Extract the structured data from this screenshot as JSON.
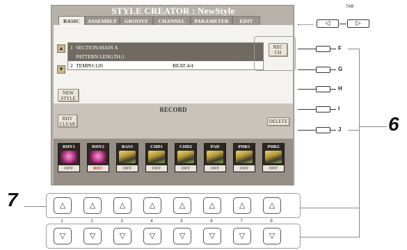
{
  "screen": {
    "title": "STYLE CREATOR : NewStyle",
    "tabs": [
      "BASIC",
      "ASSEMBLY",
      "GROOVE",
      "CHANNEL",
      "PARAMETER",
      "EDIT"
    ],
    "active_tab": "BASIC",
    "info": {
      "row1_num": "1",
      "section": "SECTION:MAIN A",
      "pattern_length": "PATTERN LENGTH:1",
      "row2_num": "2",
      "tempo": "TEMPO:120",
      "beat": "BEAT:4/4"
    },
    "rec_ch_label": "REC\nCH",
    "new_style_label": "NEW\nSTYLE",
    "record_label": "RECORD",
    "rhy_clear_label": "RHY\nCLEAR",
    "delete_label": "DELETE",
    "channels": [
      {
        "name": "RHY1",
        "state": "OFF"
      },
      {
        "name": "RHY2",
        "state": "REC"
      },
      {
        "name": "BASS",
        "state": "OFF"
      },
      {
        "name": "CHD1",
        "state": "OFF"
      },
      {
        "name": "CHD2",
        "state": "OFF"
      },
      {
        "name": "PAD",
        "state": "OFF"
      },
      {
        "name": "PHR1",
        "state": "OFF"
      },
      {
        "name": "PHR2",
        "state": "OFF"
      }
    ]
  },
  "tab_label": "TAB",
  "side_buttons": [
    "F",
    "G",
    "H",
    "I",
    "J"
  ],
  "callouts": {
    "six": "6",
    "seven": "7"
  },
  "knob_numbers": [
    "1",
    "2",
    "3",
    "4",
    "5",
    "6",
    "7",
    "8"
  ],
  "icons": {
    "up": "△",
    "down": "▽",
    "left": "◁",
    "right": "▷"
  },
  "colors": {
    "rec": "#d22020",
    "screen_bg": "#b7b1aa"
  }
}
